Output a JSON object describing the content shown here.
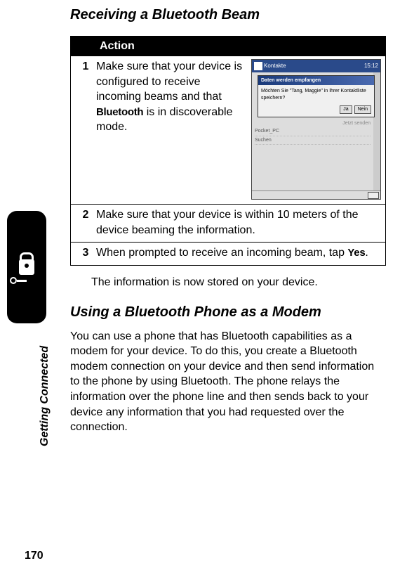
{
  "heading1": "Receiving a Bluetooth Beam",
  "table": {
    "header": "Action",
    "steps": [
      {
        "num": "1",
        "text_before": "Make sure that your device is configured to receive incoming beams and that ",
        "bold": "Bluetooth",
        "text_after": " is in discoverable mode."
      },
      {
        "num": "2",
        "text_before": "Make sure that your device is within 10 meters of the device beaming the information.",
        "bold": "",
        "text_after": ""
      },
      {
        "num": "3",
        "text_before": "When prompted to receive an incoming beam, tap ",
        "bold": "Yes",
        "text_after": "."
      }
    ]
  },
  "result": "The information is now stored on your device.",
  "heading2": "Using a Bluetooth Phone as a Modem",
  "body": "You can use a phone that has Bluetooth capabilities as a modem for your device. To do this, you create a Bluetooth modem connection on your device and then send information to the phone by using Bluetooth. The phone relays the information over the phone line and then sends back to your device any information that you had requested over the connection.",
  "section_label": "Getting Connected",
  "page_number": "170",
  "screenshot": {
    "title": "Kontakte",
    "time": "15:12",
    "dialog_title": "Daten werden empfangen",
    "dialog_body": "Möchten Sie \"Tang, Maggie\" in Ihrer Kontaktliste speichern?",
    "btn_yes": "Ja",
    "btn_no": "Nein",
    "list_item1": "Pocket_PC",
    "list_item2": "Suchen",
    "list_right": "Jetzt senden"
  }
}
